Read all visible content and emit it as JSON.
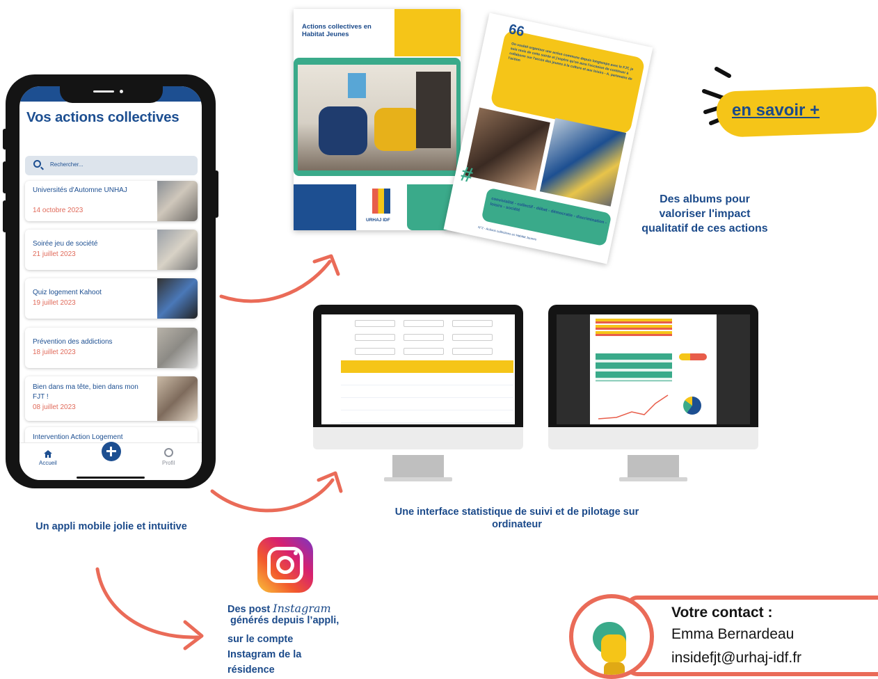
{
  "phone": {
    "title": "Vos actions collectives",
    "search_placeholder": "Rechercher...",
    "cards": [
      {
        "title": "Universités d'Automne UNHAJ",
        "date": "14 octobre 2023"
      },
      {
        "title": "Soirée jeu de société",
        "date": "21 juillet 2023"
      },
      {
        "title": "Quiz logement Kahoot",
        "date": "19 juillet 2023"
      },
      {
        "title": "Prévention des addictions",
        "date": "18 juillet 2023"
      },
      {
        "title": "Bien dans ma tête, bien dans mon FJT !",
        "date": "08 juillet 2023"
      },
      {
        "title": "Intervention Action Logement",
        "date": ""
      }
    ],
    "tabs": {
      "home": "Accueil",
      "profile": "Profil"
    }
  },
  "brochure1": {
    "title": "Actions collectives en Habitat Jeunes",
    "logo_text": "URHAJ IDF"
  },
  "brochure2": {
    "quote_mark": "66",
    "quote": "On voulait organiser une action commune depuis longtemps avec le FJT, je suis ravie de cette soirée et j'espère qu'on aura l'occasion de continuer à collaborer sur l'accès des jeunes à la culture et aux loisirs - A. partenaire de l'action",
    "hashtag_symbol": "#",
    "hashtags": "convivialité - collectif - débat - démocratie - discrimination - loisirs - société",
    "footer": "N°2 - Actions collectives en Habitat Jeunes"
  },
  "en_savoir": "en savoir +",
  "captions": {
    "albums": "Des albums pour valoriser l'impact qualitatif de ces actions",
    "stats": "Une interface statistique de suivi et de pilotage sur ordinateur",
    "mobile": "Un appli mobile jolie et intuitive",
    "insta_line1_a": "Des post",
    "insta_word": "Instagram",
    "insta_line2": "générés depuis l’appli,",
    "insta_line3": "sur le compte",
    "insta_line4": "Instagram de la",
    "insta_line5": "résidence"
  },
  "contact": {
    "label": "Votre contact :",
    "name": "Emma Bernardeau",
    "email": "insidefjt@urhaj-idf.fr"
  },
  "colors": {
    "navy": "#1b4a8a",
    "coral": "#ea6b58",
    "yellow": "#f5c518",
    "teal": "#3aaa8a"
  }
}
